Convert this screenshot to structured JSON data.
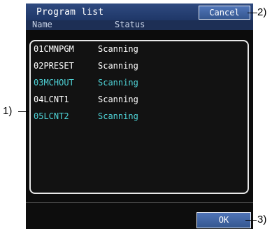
{
  "title": "Program list",
  "buttons": {
    "cancel": "Cancel",
    "ok": "OK"
  },
  "columns": {
    "name": "Name",
    "status": "Status"
  },
  "programs": [
    {
      "name": "01CMNPGM",
      "status": "Scanning",
      "color": "#ffffff"
    },
    {
      "name": "02PRESET",
      "status": "Scanning",
      "color": "#ffffff"
    },
    {
      "name": "03MCHOUT",
      "status": "Scanning",
      "color": "#4fd4d8"
    },
    {
      "name": "04LCNT1",
      "status": "Scanning",
      "color": "#ffffff"
    },
    {
      "name": "05LCNT2",
      "status": "Scanning",
      "color": "#4fd4d8"
    }
  ],
  "callouts": {
    "list": "1)",
    "cancel": "2)",
    "ok": "3)"
  }
}
